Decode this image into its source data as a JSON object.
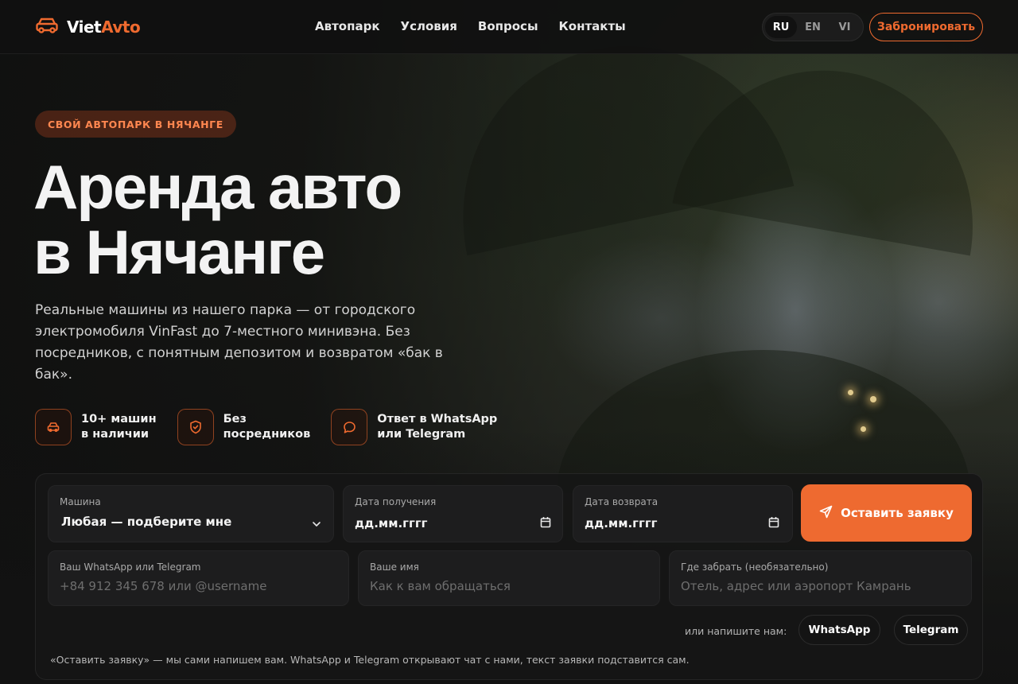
{
  "brand": {
    "name_part1": "Viet",
    "name_part2": "Avto",
    "accent_color": "#ef6a2f",
    "logo_icon": "car-icon"
  },
  "nav": {
    "links": [
      "Автопарк",
      "Условия",
      "Вопросы",
      "Контакты"
    ],
    "languages": [
      "RU",
      "EN",
      "VI"
    ],
    "active_language": "RU",
    "cta_label": "Забронировать"
  },
  "hero": {
    "badge": "СВОЙ АВТОПАРК В НЯЧАНГЕ",
    "title_line1": "Аренда авто",
    "title_line2": "в Нячанге",
    "subtitle": "Реальные машины из нашего парка — от городского электромобиля VinFast до 7-местного минивэна. Без посредников, с понятным депозитом и возвратом «бак в бак».",
    "features": [
      {
        "icon": "car-icon",
        "line1": "10+ машин",
        "line2": "в наличии"
      },
      {
        "icon": "shield-check-icon",
        "line1": "Без",
        "line2": "посредников"
      },
      {
        "icon": "chat-bubble-icon",
        "line1": "Ответ в WhatsApp",
        "line2": "или Telegram"
      }
    ]
  },
  "booking": {
    "car": {
      "label": "Машина",
      "value": "Любая — подберите мне"
    },
    "pickup_date": {
      "label": "Дата получения",
      "value": "дд.мм.гггг"
    },
    "return_date": {
      "label": "Дата возврата",
      "value": "дд.мм.гггг"
    },
    "submit_label": "Оставить заявку",
    "contact": {
      "label": "Ваш WhatsApp или Telegram",
      "placeholder": "+84 912 345 678 или @username"
    },
    "name": {
      "label": "Ваше имя",
      "placeholder": "Как к вам обращаться"
    },
    "location": {
      "label": "Где забрать (необязательно)",
      "placeholder": "Отель, адрес или аэропорт Камрань"
    },
    "alt_contact_label": "или напишите нам:",
    "whatsapp_label": "WhatsApp",
    "telegram_label": "Telegram",
    "note": "«Оставить заявку» — мы сами напишем вам. WhatsApp и Telegram открывают чат с нами, текст заявки подставится сам."
  }
}
